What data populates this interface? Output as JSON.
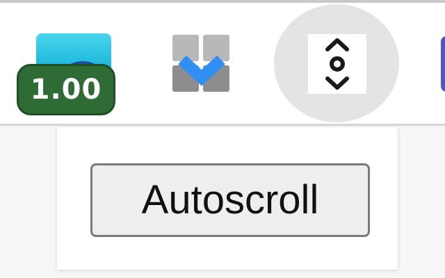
{
  "toolbar": {
    "extensions": [
      {
        "name": "teal-extension",
        "icon": "teal-wave-icon",
        "badge": "1.00",
        "badge_color": "#2e6b35"
      },
      {
        "name": "grid-extension",
        "icon": "grid-chevron-icon",
        "accent_color": "#2f8ff5"
      },
      {
        "name": "autoscroll-extension",
        "icon": "autoscroll-icon",
        "active": true
      }
    ]
  },
  "popup": {
    "button_label": "Autoscroll"
  }
}
